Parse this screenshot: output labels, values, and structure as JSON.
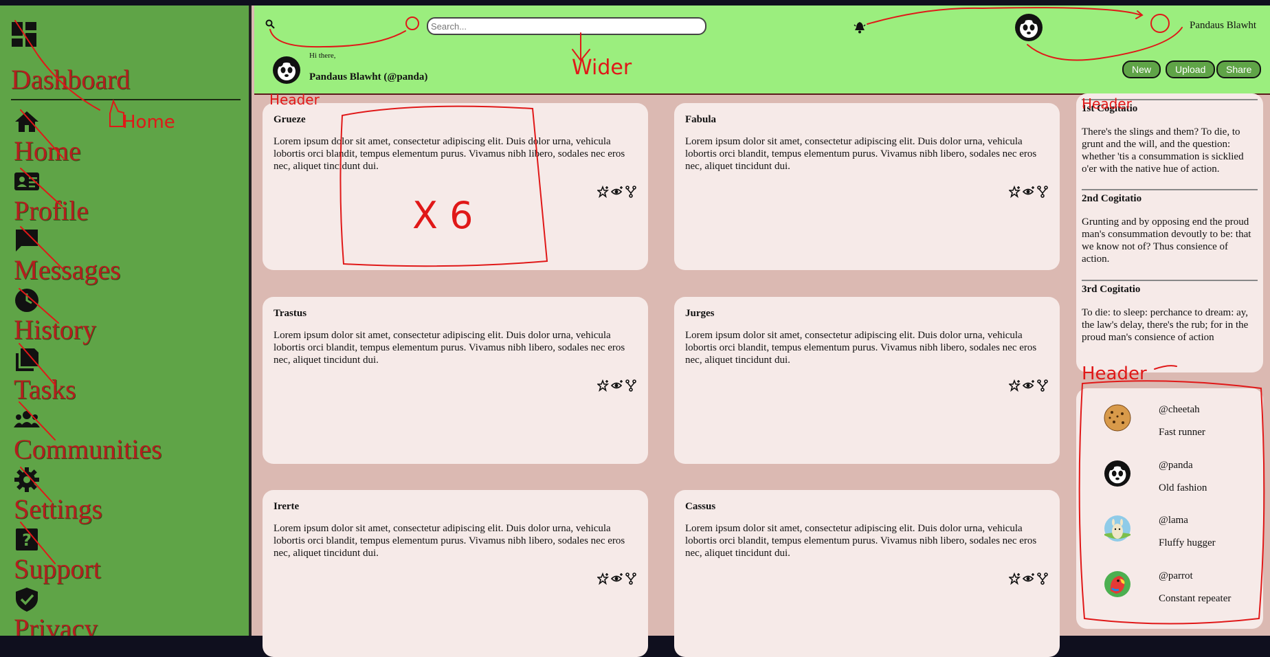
{
  "sidebar": {
    "title": "Dashboard",
    "items": [
      {
        "label": "Home",
        "icon": "home-icon"
      },
      {
        "label": "Profile",
        "icon": "id-card-icon"
      },
      {
        "label": "Messages",
        "icon": "chat-bubble-icon"
      },
      {
        "label": "History",
        "icon": "clock-icon"
      },
      {
        "label": "Tasks",
        "icon": "documents-icon"
      },
      {
        "label": "Communities",
        "icon": "group-icon"
      },
      {
        "label": "Settings",
        "icon": "gear-icon"
      },
      {
        "label": "Support",
        "icon": "help-icon"
      },
      {
        "label": "Privacy",
        "icon": "shield-check-icon"
      }
    ]
  },
  "header": {
    "search_placeholder": "Search...",
    "username": "Pandaus Blawht",
    "greeting": "Hi there,",
    "greeting_name": "Pandaus Blawht (@panda)",
    "buttons": {
      "new": "New",
      "upload": "Upload",
      "share": "Share"
    }
  },
  "cards": [
    {
      "title": "Grueze",
      "body": "Lorem ipsum dolor sit amet, consectetur adipiscing elit. Duis dolor urna, vehicula lobortis orci blandit, tempus elementum purus. Vivamus nibh libero, sodales nec eros nec, aliquet tincidunt dui."
    },
    {
      "title": "Fabula",
      "body": "Lorem ipsum dolor sit amet, consectetur adipiscing elit. Duis dolor urna, vehicula lobortis orci blandit, tempus elementum purus. Vivamus nibh libero, sodales nec eros nec, aliquet tincidunt dui."
    },
    {
      "title": "Trastus",
      "body": "Lorem ipsum dolor sit amet, consectetur adipiscing elit. Duis dolor urna, vehicula lobortis orci blandit, tempus elementum purus. Vivamus nibh libero, sodales nec eros nec, aliquet tincidunt dui."
    },
    {
      "title": "Jurges",
      "body": "Lorem ipsum dolor sit amet, consectetur adipiscing elit. Duis dolor urna, vehicula lobortis orci blandit, tempus elementum purus. Vivamus nibh libero, sodales nec eros nec, aliquet tincidunt dui."
    },
    {
      "title": "Irerte",
      "body": "Lorem ipsum dolor sit amet, consectetur adipiscing elit. Duis dolor urna, vehicula lobortis orci blandit, tempus elementum purus. Vivamus nibh libero, sodales nec eros nec, aliquet tincidunt dui."
    },
    {
      "title": "Cassus",
      "body": "Lorem ipsum dolor sit amet, consectetur adipiscing elit. Duis dolor urna, vehicula lobortis orci blandit, tempus elementum purus. Vivamus nibh libero, sodales nec eros nec, aliquet tincidunt dui."
    }
  ],
  "card_action_icons": [
    "star-plus-icon",
    "eye-plus-icon",
    "fork-icon"
  ],
  "announcements": [
    {
      "title": "1st Cogitatio",
      "body": "There's the slings and them? To die, to grunt and the will, and the question: whether 'tis a consummation is sicklied o'er with the native hue of action."
    },
    {
      "title": "2nd Cogitatio",
      "body": "Grunting and by opposing end the proud man's consummation devoutly to be: that we know not of? Thus consience of action."
    },
    {
      "title": "3rd Cogitatio",
      "body": "To die: to sleep: perchance to dream: ay, the law's delay, there's the rub; for in the proud man's consience of action"
    }
  ],
  "trending_users": [
    {
      "handle": "@cheetah",
      "desc": "Fast runner",
      "avatar": "cheetah-avatar"
    },
    {
      "handle": "@panda",
      "desc": "Old fashion",
      "avatar": "panda-avatar"
    },
    {
      "handle": "@lama",
      "desc": "Fluffy hugger",
      "avatar": "llama-avatar"
    },
    {
      "handle": "@parrot",
      "desc": "Constant repeater",
      "avatar": "parrot-avatar"
    }
  ],
  "annotations": {
    "home_note": "Home",
    "wider_note": "Wider",
    "header_note_1": "Header",
    "header_note_2": "Header",
    "header_note_3": "Header",
    "x6_note": "X 6"
  },
  "colors": {
    "sidebar_bg": "#5fa447",
    "header_bg": "#9bee7e",
    "content_bg": "#dbb9b2",
    "card_bg": "#f6eae8",
    "annotation_red": "#e01818"
  }
}
